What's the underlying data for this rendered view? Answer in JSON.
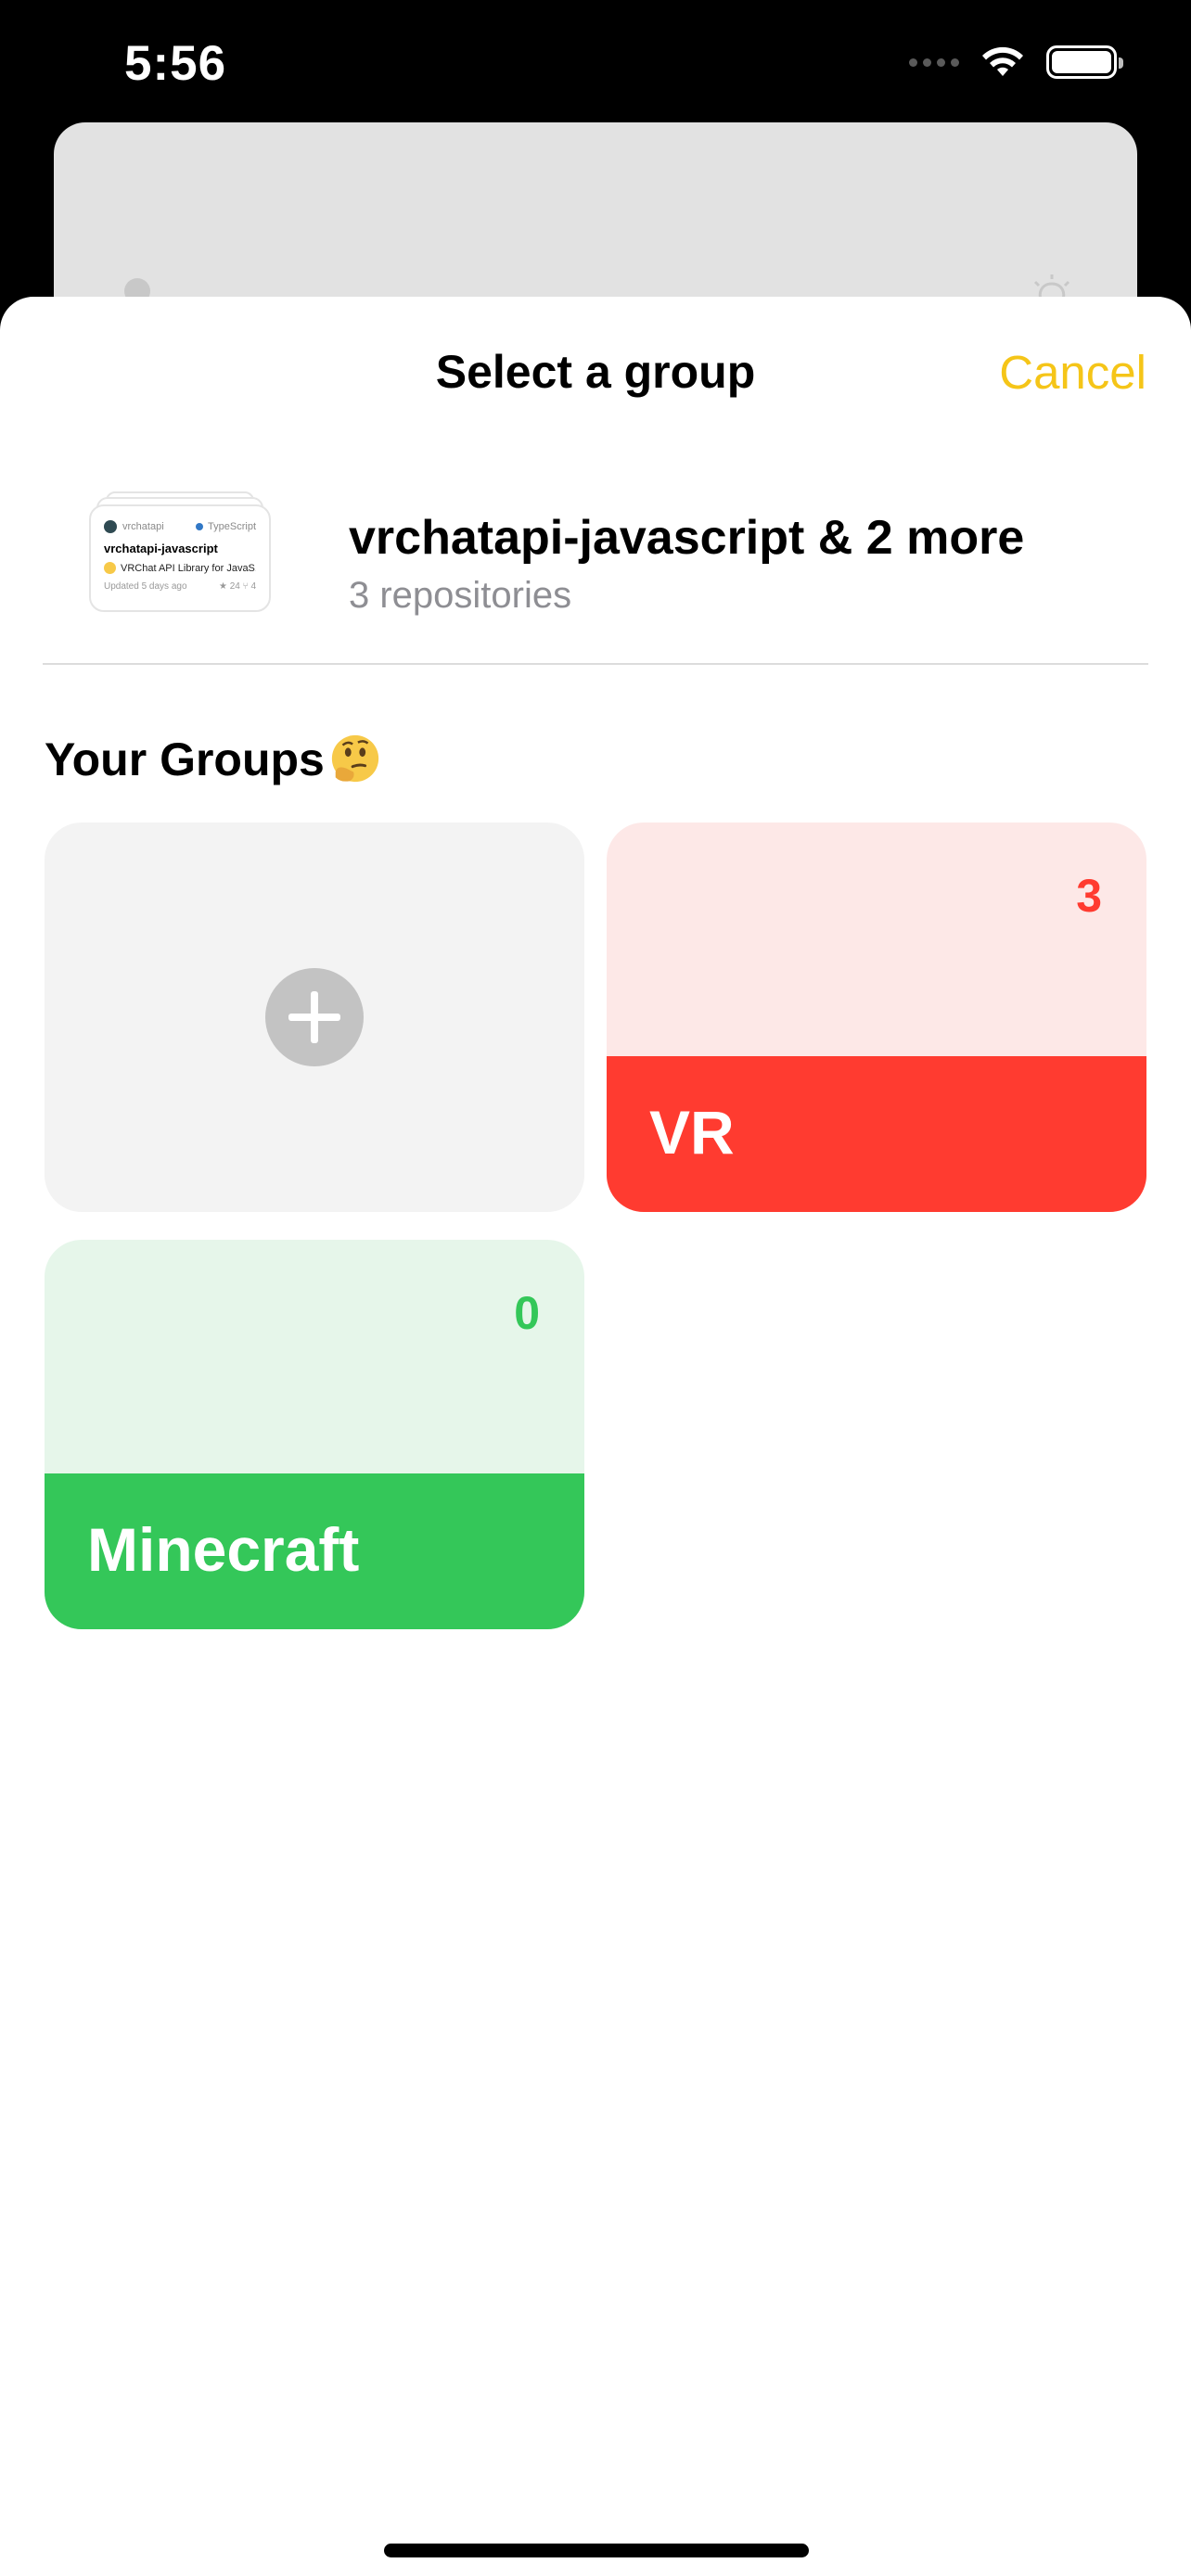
{
  "status_bar": {
    "time": "5:56",
    "icons": [
      "signal-icon",
      "wifi-icon",
      "battery-icon"
    ]
  },
  "sheet": {
    "title": "Select a group",
    "cancel_label": "Cancel",
    "accent_color": "#F5C518"
  },
  "selection": {
    "title": "vrchatapi-javascript & 2 more",
    "subtitle": "3 repositories",
    "preview_card": {
      "owner": "vrchatapi",
      "language": "TypeScript",
      "repo_name": "vrchatapi-javascript",
      "description": "VRChat API Library for JavaS...",
      "updated": "Updated 5 days ago",
      "stars": "24",
      "forks": "4"
    }
  },
  "groups_section": {
    "heading": "Your Groups",
    "heading_icon": "thinking-face-icon",
    "add_tile_icon": "plus-icon",
    "groups": [
      {
        "name": "VR",
        "count": "3",
        "color": "#FF3B30",
        "tint": "#FDE8E7"
      },
      {
        "name": "Minecraft",
        "count": "0",
        "color": "#34C759",
        "tint": "#E6F6EA"
      }
    ]
  }
}
